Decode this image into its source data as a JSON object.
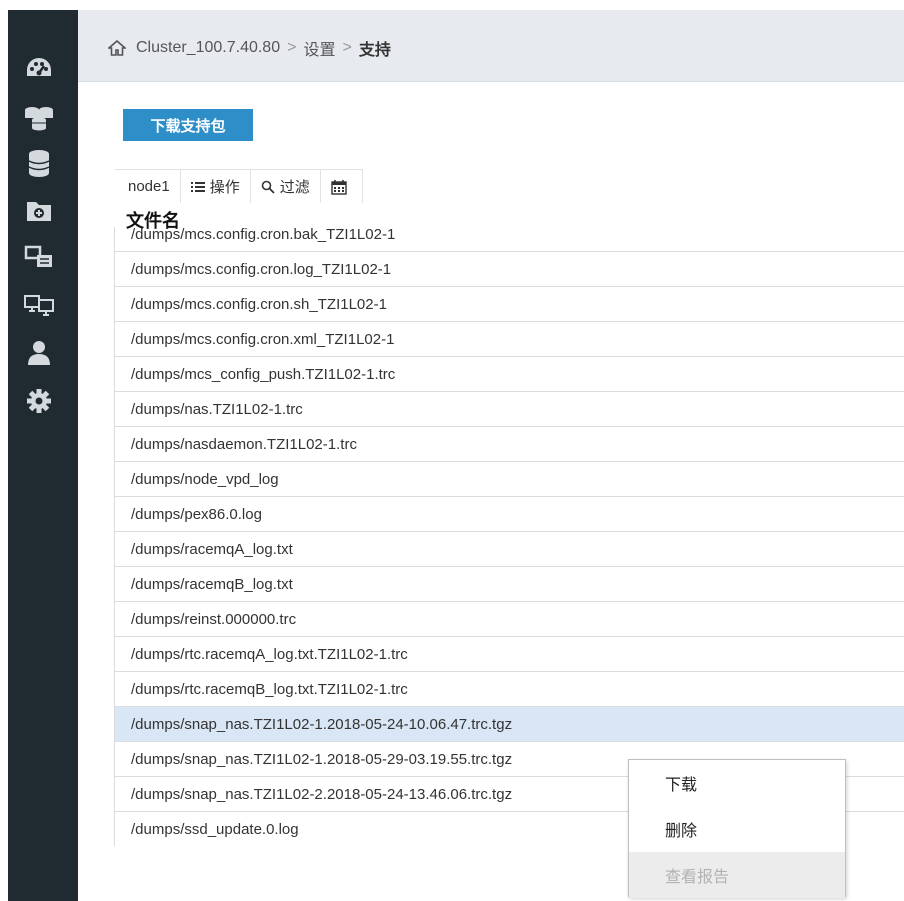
{
  "breadcrumb": {
    "items": [
      "Cluster_100.7.40.80",
      "设置",
      "支持"
    ],
    "separator": ">"
  },
  "sidebar": {
    "items": [
      {
        "icon": "dashboard-icon"
      },
      {
        "icon": "pools-icon"
      },
      {
        "icon": "volumes-icon"
      },
      {
        "icon": "hosts-folder-icon"
      },
      {
        "icon": "copy-services-icon"
      },
      {
        "icon": "monitors-icon"
      },
      {
        "icon": "user-icon"
      },
      {
        "icon": "settings-gear-icon"
      }
    ]
  },
  "actions": {
    "download_support_package": "下载支持包"
  },
  "toolbar": {
    "node": "node1",
    "actions_label": "操作",
    "filter_label": "过滤",
    "calendar_icon": "calendar-icon"
  },
  "table": {
    "column_header": "文件名",
    "rows": [
      "/dumps/mcs.config.cron.bak_TZI1L02-1",
      "/dumps/mcs.config.cron.log_TZI1L02-1",
      "/dumps/mcs.config.cron.sh_TZI1L02-1",
      "/dumps/mcs.config.cron.xml_TZI1L02-1",
      "/dumps/mcs_config_push.TZI1L02-1.trc",
      "/dumps/nas.TZI1L02-1.trc",
      "/dumps/nasdaemon.TZI1L02-1.trc",
      "/dumps/node_vpd_log",
      "/dumps/pex86.0.log",
      "/dumps/racemqA_log.txt",
      "/dumps/racemqB_log.txt",
      "/dumps/reinst.000000.trc",
      "/dumps/rtc.racemqA_log.txt.TZI1L02-1.trc",
      "/dumps/rtc.racemqB_log.txt.TZI1L02-1.trc",
      "/dumps/snap_nas.TZI1L02-1.2018-05-24-10.06.47.trc.tgz",
      "/dumps/snap_nas.TZI1L02-1.2018-05-29-03.19.55.trc.tgz",
      "/dumps/snap_nas.TZI1L02-2.2018-05-24-13.46.06.trc.tgz",
      "/dumps/ssd_update.0.log"
    ],
    "selected_index": 14
  },
  "context_menu": {
    "items": [
      {
        "label": "下载",
        "enabled": true
      },
      {
        "label": "删除",
        "enabled": true
      },
      {
        "label": "查看报告",
        "enabled": false
      }
    ]
  },
  "colors": {
    "sidebar_bg": "#202b31",
    "header_bg": "#e7ebf0",
    "accent_button": "#2e8fc8",
    "selected_row": "#d9e6f5",
    "icon_color": "#d4d9dd"
  }
}
